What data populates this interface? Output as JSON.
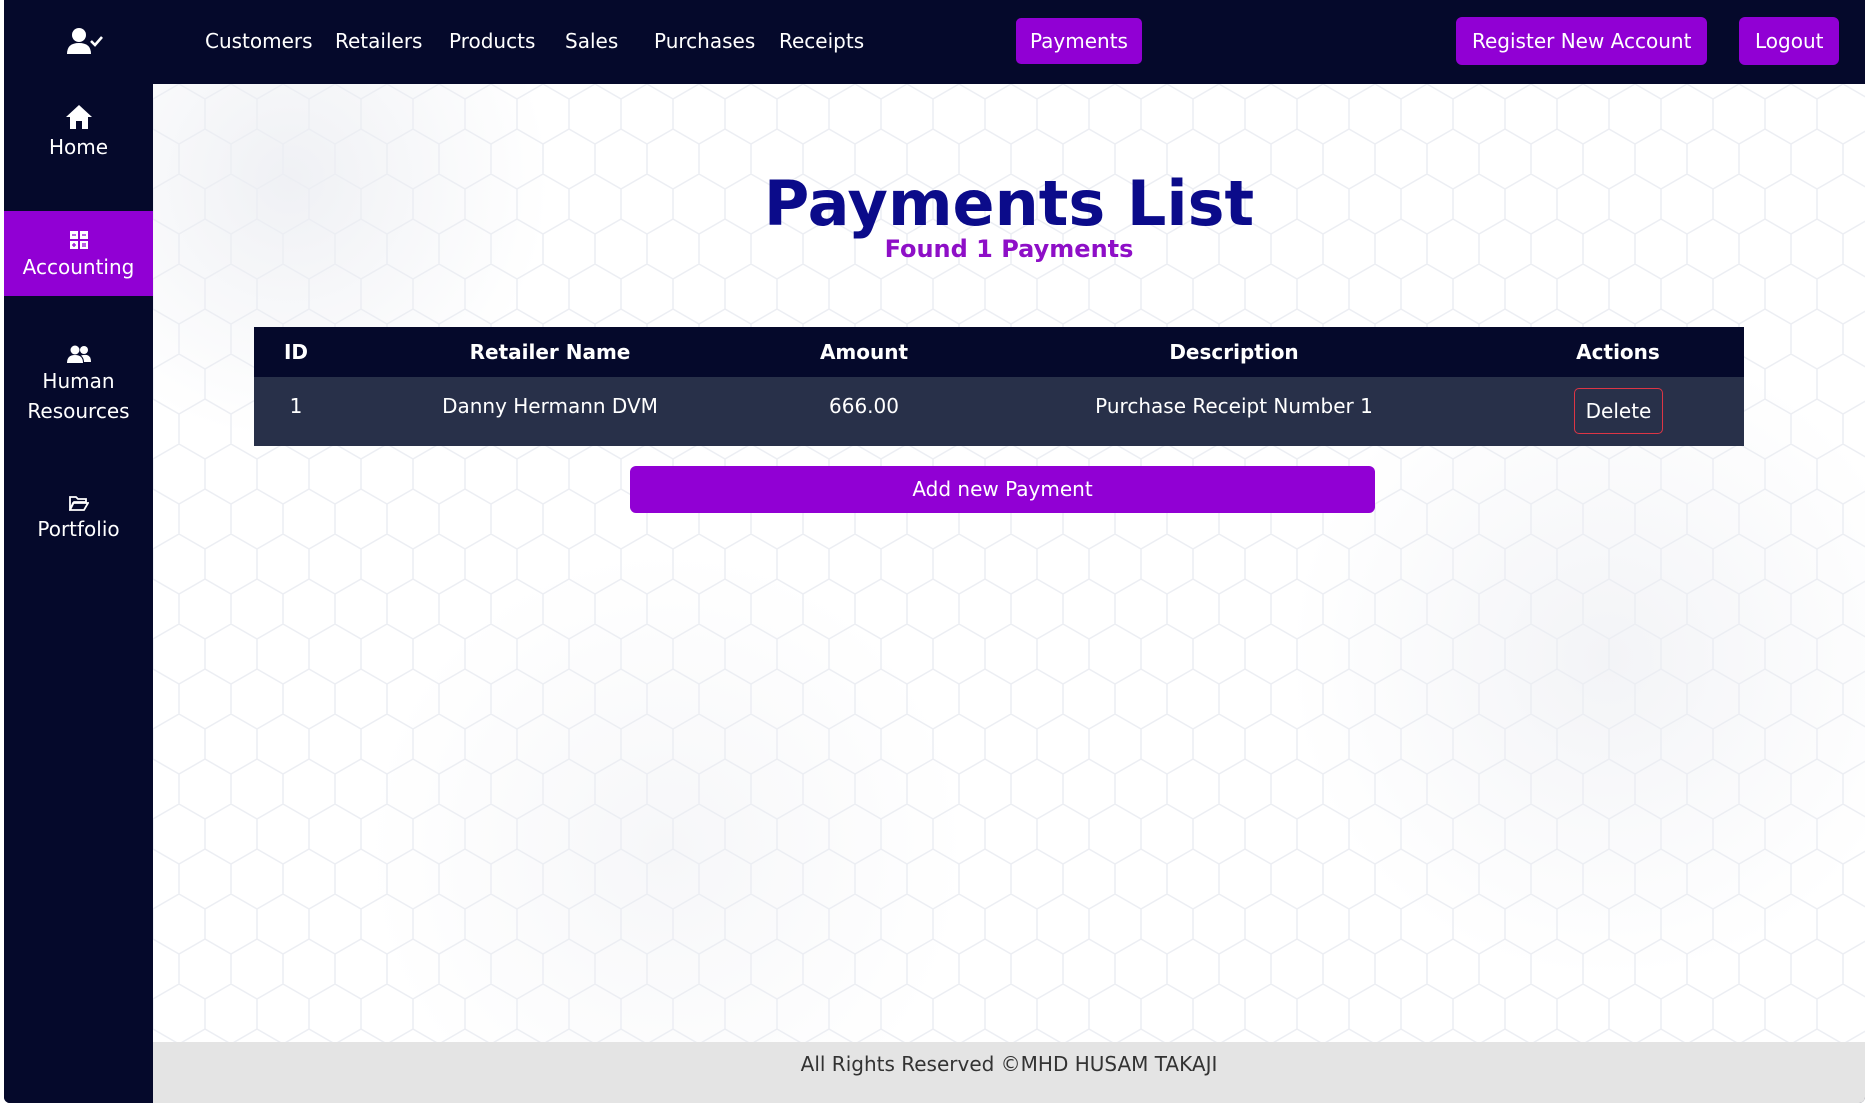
{
  "colors": {
    "nav_bg": "#05092b",
    "accent": "#9100d4",
    "title": "#0b0b8a",
    "subtitle": "#8e0fc7",
    "table_row": "#283049",
    "danger": "#dc3545",
    "footer_bg": "#e4e4e4"
  },
  "sidebar": {
    "brand_icon": "user-check-icon",
    "items": [
      {
        "label": "Home",
        "icon": "home-icon",
        "active": false
      },
      {
        "label": "Accounting",
        "icon": "calculator-icon",
        "active": true
      },
      {
        "label_line1": "Human",
        "label_line2": "Resources",
        "icon": "users-icon",
        "active": false
      },
      {
        "label": "Portfolio",
        "icon": "folder-open-icon",
        "active": false
      }
    ]
  },
  "topnav": {
    "links": [
      "Customers",
      "Retailers",
      "Products",
      "Sales",
      "Purchases",
      "Receipts",
      "Payments"
    ],
    "active_link": "Payments",
    "register_label": "Register New Account",
    "logout_label": "Logout"
  },
  "main": {
    "title": "Payments List",
    "subtitle": "Found 1 Payments",
    "table": {
      "headers": [
        "ID",
        "Retailer Name",
        "Amount",
        "Description",
        "Actions"
      ],
      "rows": [
        {
          "id": "1",
          "retailer": "Danny Hermann DVM",
          "amount": "666.00",
          "description": "Purchase Receipt Number 1",
          "action": "Delete"
        }
      ]
    },
    "add_button": "Add new Payment"
  },
  "footer": {
    "text": "All Rights Reserved ©MHD HUSAM TAKAJI"
  }
}
